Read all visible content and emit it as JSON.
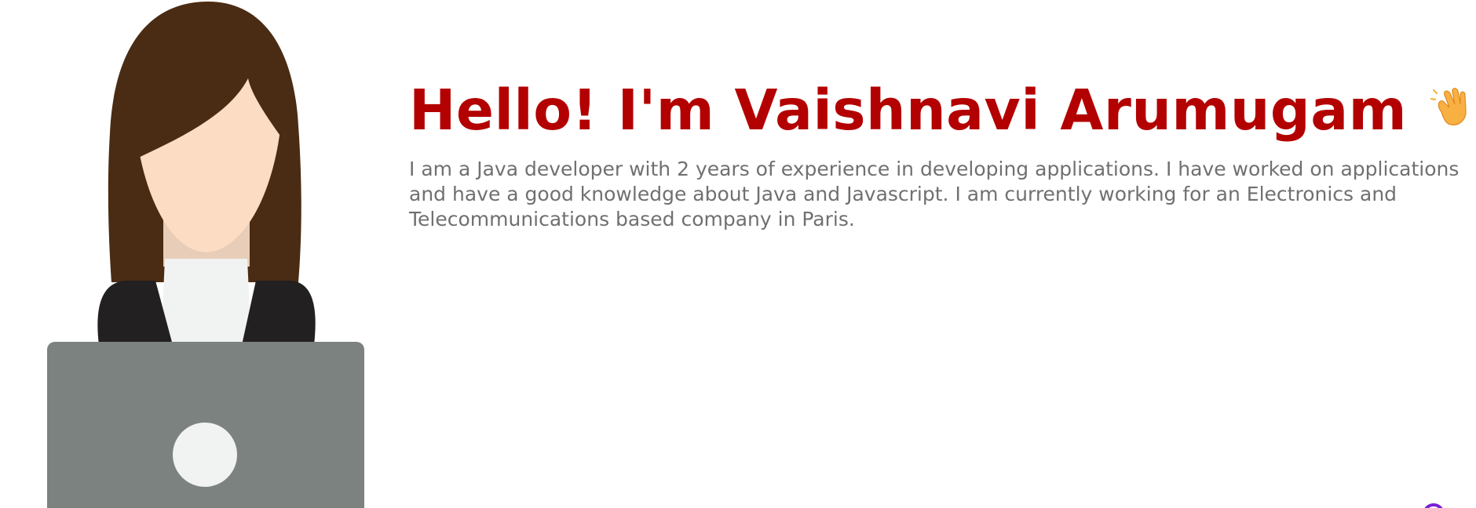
{
  "hero": {
    "greeting": "Hello! I'm Vaishnavi Arumugam",
    "wave_icon": "waving-hand-emoji",
    "bio_lines": [
      "I am a Java developer with 2 years of experience in developing applications. I have worked on applications",
      "and have a good knowledge about Java and Javascript. I am currently working for an Electronics and",
      "Telecommunications based company in Paris."
    ]
  },
  "illustration": {
    "subject": "developer-at-laptop-illustration"
  },
  "colors": {
    "greeting": "#b30000",
    "bio_text": "#707070",
    "hair": "#4a2c14",
    "skin": "#fcdcc2",
    "neck": "#e8cdb8",
    "jacket": "#222020",
    "shirt": "#f1f2f2",
    "laptop": "#7c8280",
    "laptop_logo": "#f1f2f2",
    "corner_accent": "#7a1fd6"
  }
}
